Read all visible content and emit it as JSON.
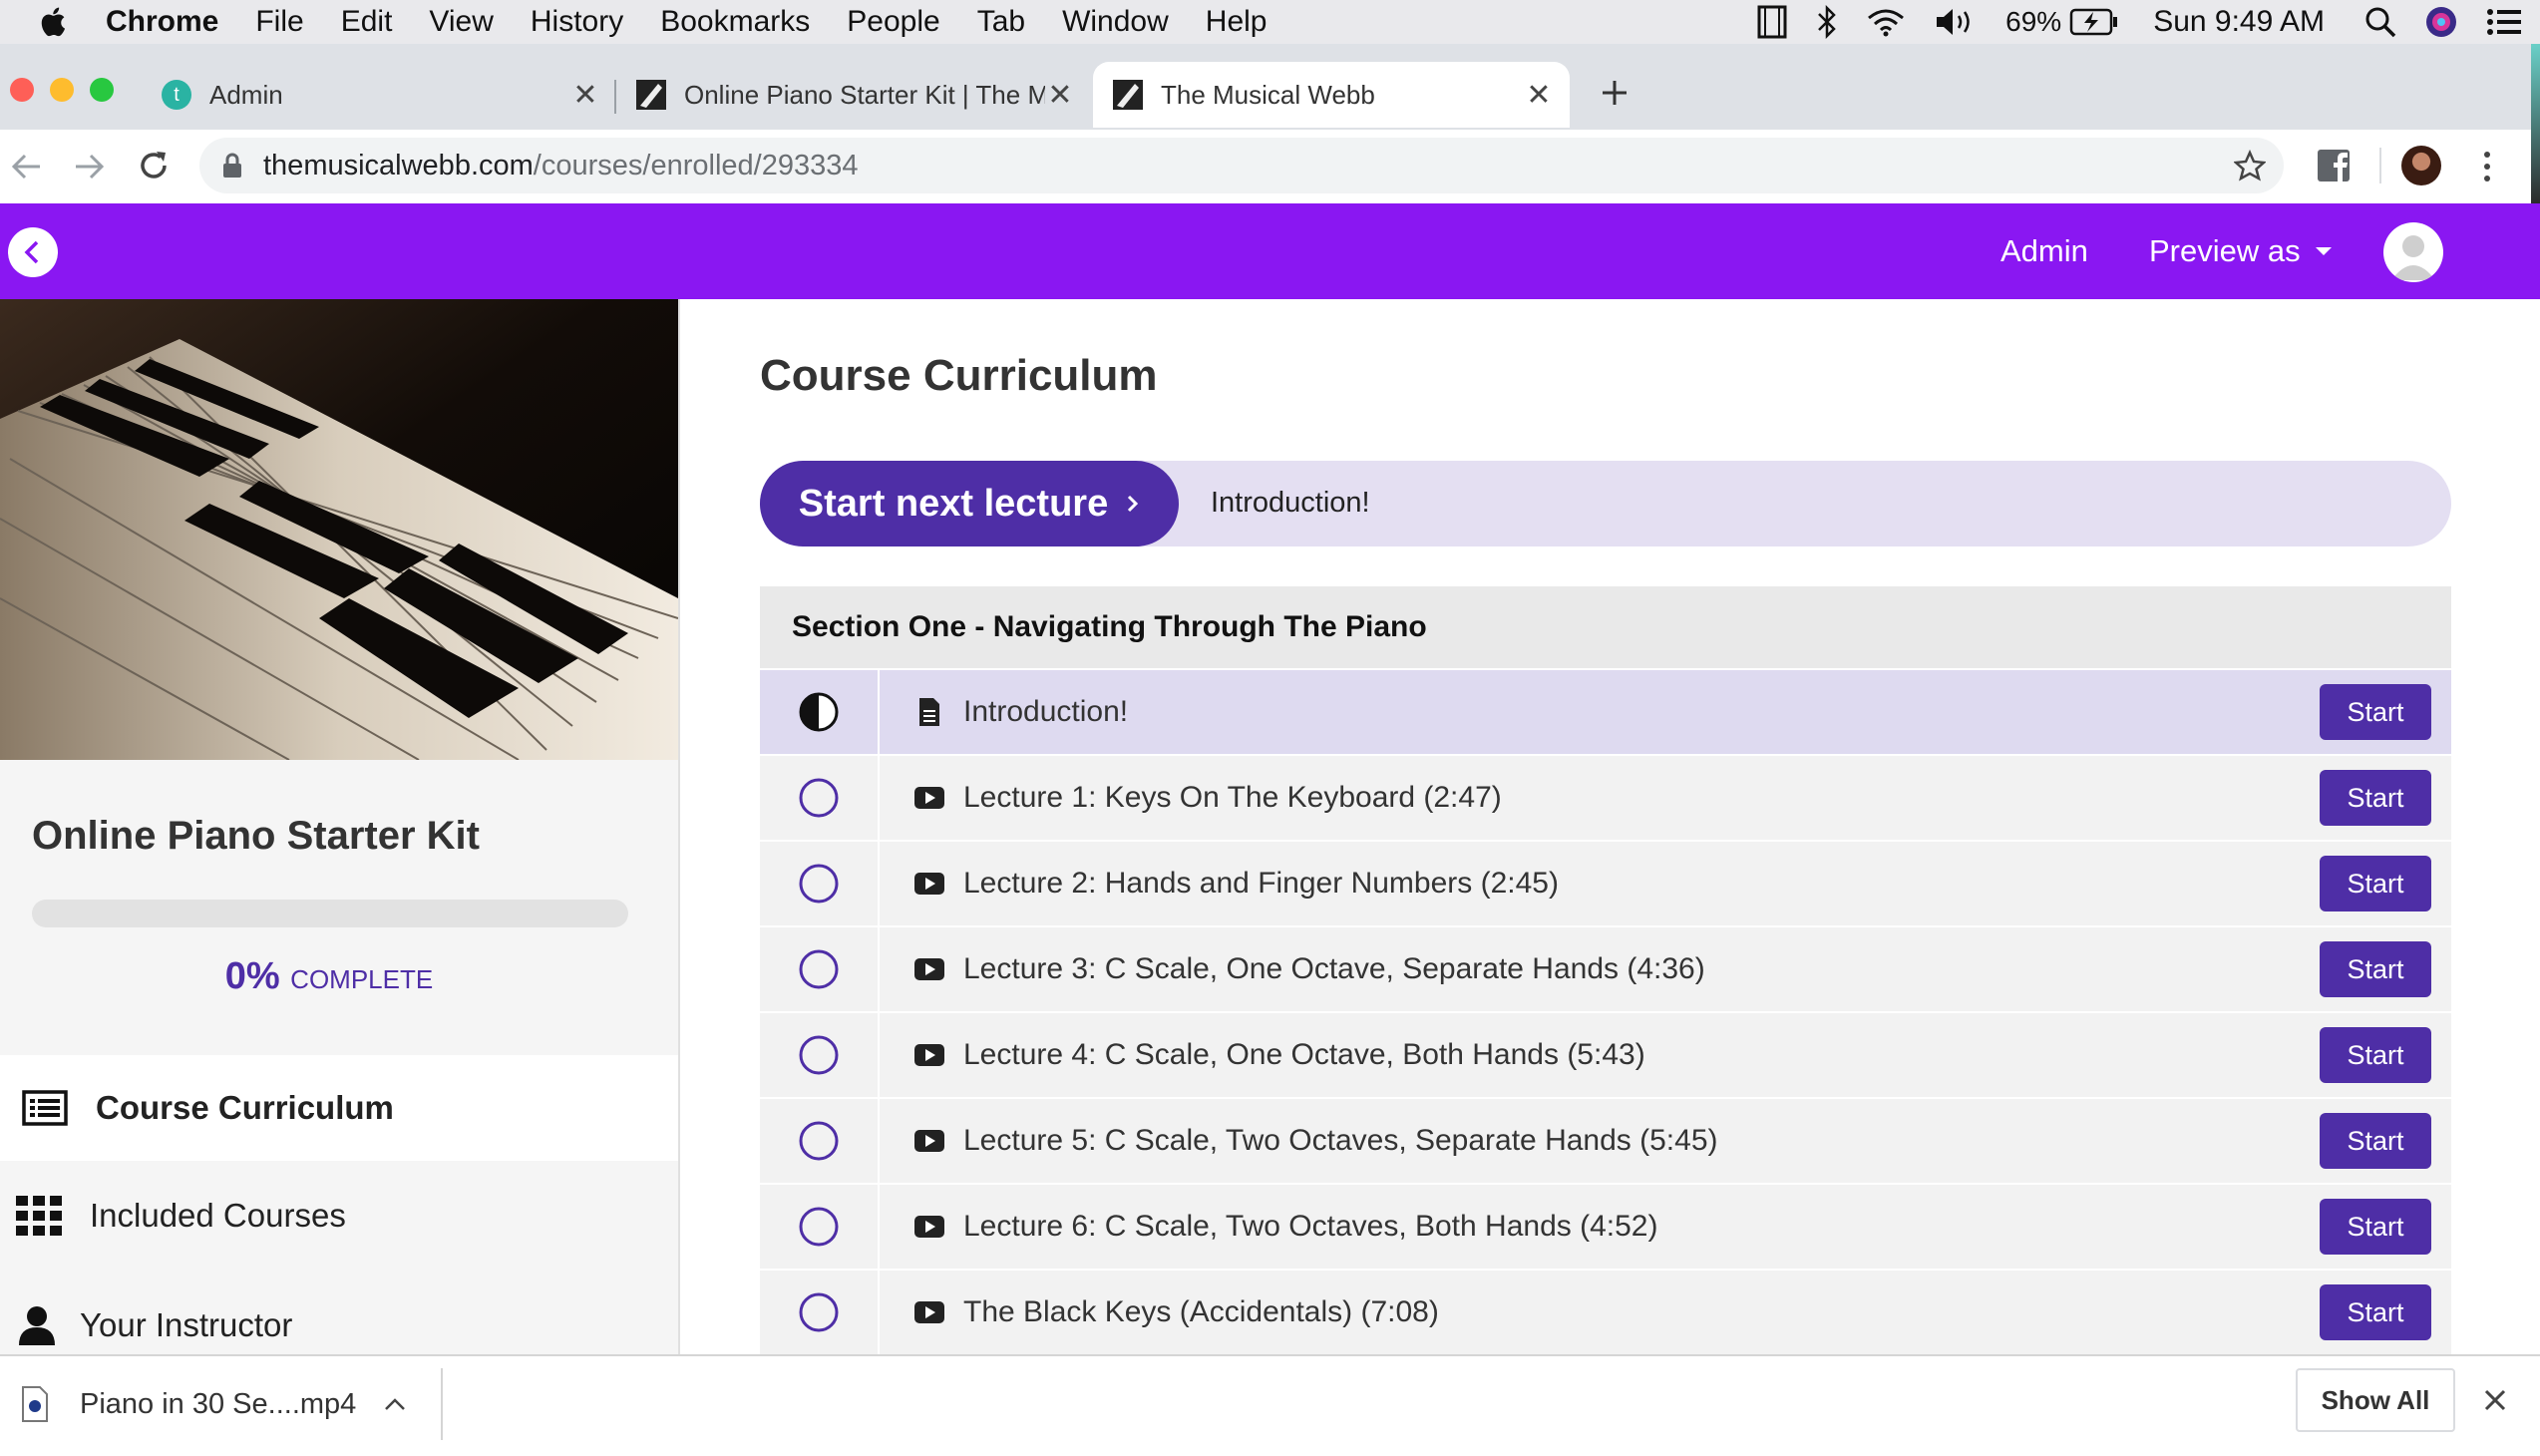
{
  "menubar": {
    "app": "Chrome",
    "items": [
      "File",
      "Edit",
      "View",
      "History",
      "Bookmarks",
      "People",
      "Tab",
      "Window",
      "Help"
    ],
    "battery": "69%",
    "clock": "Sun 9:49 AM"
  },
  "tabs": [
    {
      "title": "Admin",
      "favicon": "t"
    },
    {
      "title": "Online Piano Starter Kit | The Musical Webb"
    },
    {
      "title": "The Musical Webb"
    }
  ],
  "omnibox": {
    "host": "themusicalwebb.com",
    "path": "/courses/enrolled/293334"
  },
  "site_header": {
    "admin": "Admin",
    "preview_as": "Preview as"
  },
  "sidebar": {
    "course_title": "Online Piano Starter Kit",
    "progress_percent": 0,
    "percent_label": "0%",
    "complete_label": "COMPLETE",
    "nav": [
      "Course Curriculum",
      "Included Courses",
      "Your Instructor"
    ]
  },
  "main": {
    "heading": "Course Curriculum",
    "next_btn": "Start next lecture",
    "next_lecture": "Introduction!",
    "section_title": "Section One - Navigating Through The Piano",
    "start_label": "Start",
    "lectures": [
      "Introduction!",
      "Lecture 1: Keys On The Keyboard (2:47)",
      "Lecture 2: Hands and Finger Numbers (2:45)",
      "Lecture 3: C Scale, One Octave, Separate Hands (4:36)",
      "Lecture 4: C Scale, One Octave, Both Hands (5:43)",
      "Lecture 5: C Scale, Two Octaves, Separate Hands (5:45)",
      "Lecture 6: C Scale, Two Octaves, Both Hands (4:52)",
      "The Black Keys (Accidentals) (7:08)"
    ]
  },
  "downloads": {
    "file": "Piano in 30 Se....mp4",
    "show_all": "Show All"
  },
  "colors": {
    "header": "#8a17f2",
    "accent": "#4e2ea6",
    "highlight": "#dedaf0",
    "pill": "#e4dff2"
  }
}
